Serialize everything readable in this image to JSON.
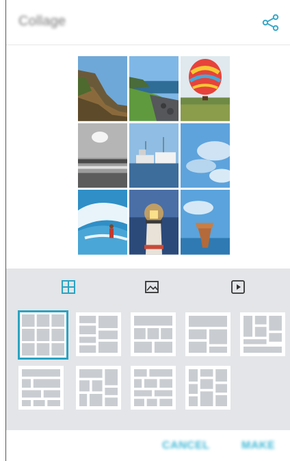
{
  "header": {
    "title": "Collage",
    "share_icon": "share-icon"
  },
  "tabs": [
    {
      "id": "layout",
      "icon": "grid-layout-icon",
      "active": true
    },
    {
      "id": "background",
      "icon": "image-icon",
      "active": false
    },
    {
      "id": "video",
      "icon": "play-icon",
      "active": false
    }
  ],
  "photos": [
    "cliff-coast",
    "rocky-shore",
    "hot-air-balloon",
    "sun-over-water",
    "harbor-ships",
    "blue-sky-clouds",
    "surfer-wave",
    "lighthouse-dusk",
    "rock-formation-sea"
  ],
  "layouts": {
    "count": 9,
    "selected_index": 0
  },
  "footer": {
    "cancel_label": "CANCEL",
    "make_label": "MAKE"
  },
  "colors": {
    "accent": "#2aa3c2",
    "panel_bg": "#e3e5e8",
    "tile": "#c9cdd2"
  }
}
